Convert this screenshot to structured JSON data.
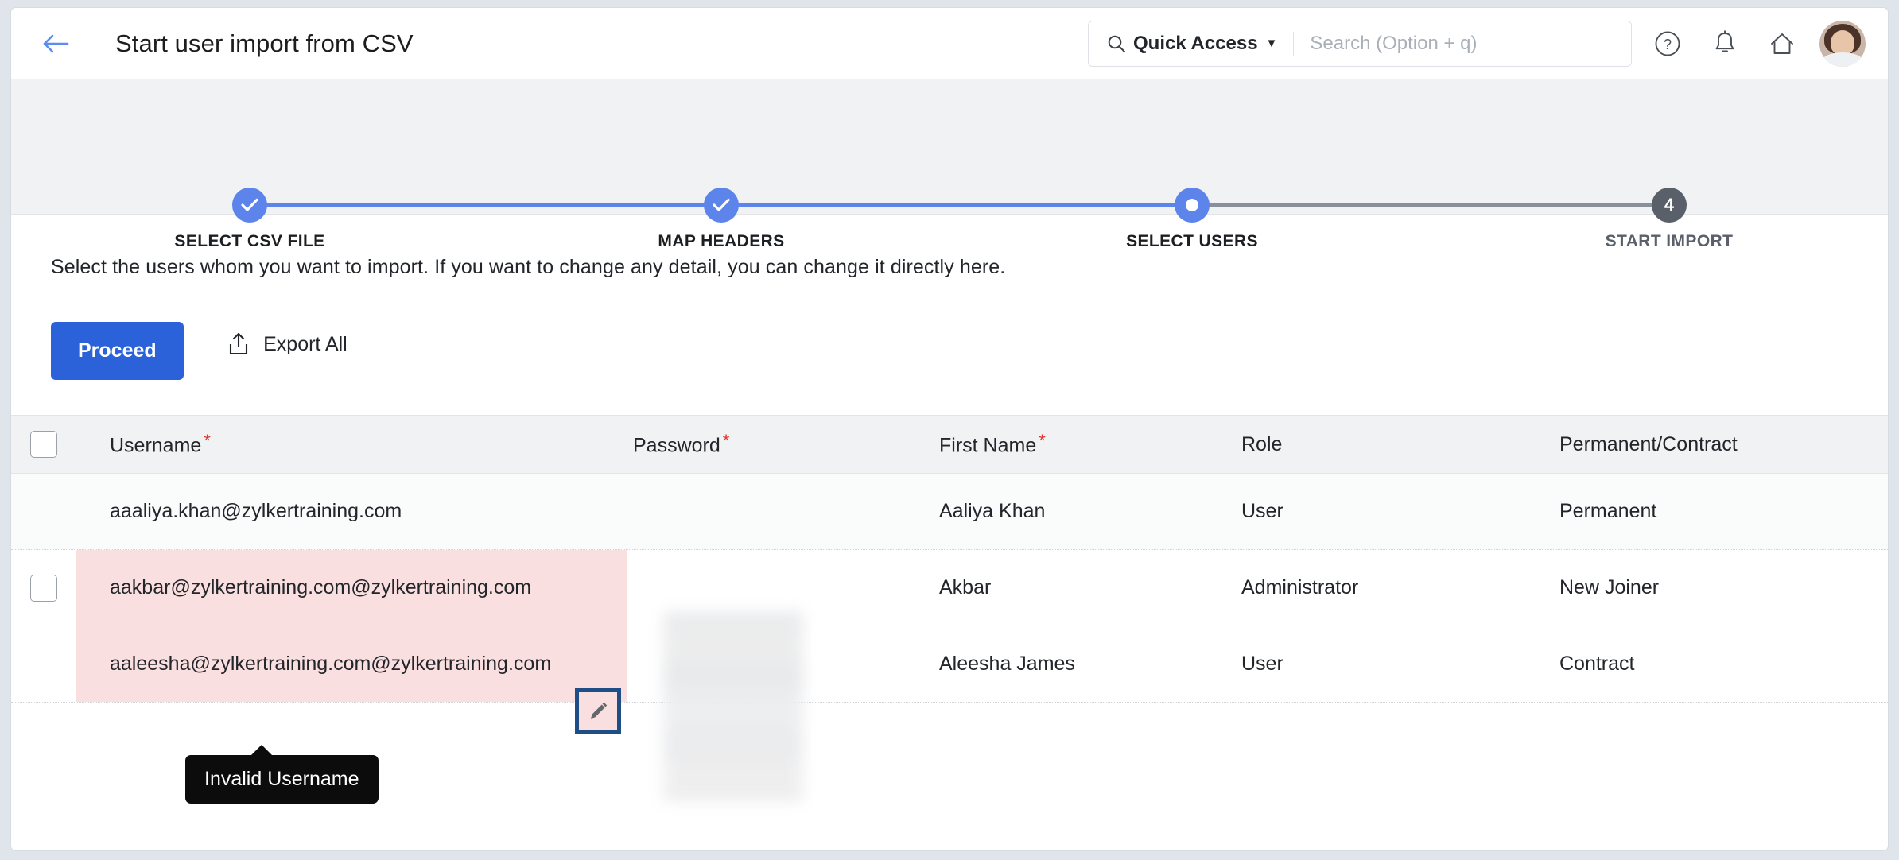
{
  "header": {
    "back_icon": "arrow-left-icon",
    "title": "Start user import from CSV",
    "search": {
      "search_icon": "search-icon",
      "scope_label": "Quick Access",
      "caret": "▼",
      "placeholder": "Search (Option + q)",
      "value": ""
    },
    "help_icon": "help-circle-icon",
    "bell_icon": "bell-icon",
    "home_icon": "home-icon",
    "avatar": "user-avatar"
  },
  "stepper": {
    "steps": [
      {
        "label": "SELECT CSV FILE",
        "state": "done",
        "marker": "✓"
      },
      {
        "label": "MAP HEADERS",
        "state": "done",
        "marker": "✓"
      },
      {
        "label": "SELECT USERS",
        "state": "current",
        "marker": ""
      },
      {
        "label": "START IMPORT",
        "state": "todo",
        "marker": "4"
      }
    ],
    "colors": {
      "done": "#5c84ea",
      "todo": "#5a6069",
      "track_done": "#5c84ea",
      "track_todo": "#8a9099"
    }
  },
  "main": {
    "instruction": "Select the users whom you want to import. If you want to change any detail, you can change it directly here.",
    "proceed_label": "Proceed",
    "export_label": "Export All",
    "export_icon": "upload-share-icon"
  },
  "table": {
    "columns": [
      {
        "key": "username",
        "label": "Username",
        "required": true
      },
      {
        "key": "password",
        "label": "Password",
        "required": true
      },
      {
        "key": "first",
        "label": "First Name",
        "required": true
      },
      {
        "key": "role",
        "label": "Role",
        "required": false
      },
      {
        "key": "perm",
        "label": "Permanent/Contract",
        "required": false
      }
    ],
    "required_marker": "*",
    "header_checkbox": {
      "checked": false
    },
    "rows": [
      {
        "checkbox_visible": false,
        "checked": false,
        "username": "aaaliya.khan@zylkertraining.com",
        "password_masked": true,
        "first": "Aaliya Khan",
        "role": "User",
        "perm": "Permanent",
        "error": false
      },
      {
        "checkbox_visible": true,
        "checked": false,
        "username": "aakbar@zylkertraining.com@zylkertraining.com",
        "password_masked": true,
        "first": "Akbar",
        "role": "Administrator",
        "perm": "New Joiner",
        "error": true
      },
      {
        "checkbox_visible": false,
        "checked": false,
        "username": "aaleesha@zylkertraining.com@zylkertraining.com",
        "password_masked": true,
        "first": "Aleesha James",
        "role": "User",
        "perm": "Contract",
        "error": true
      }
    ],
    "error_row_bg": "#fadfe0"
  },
  "overlays": {
    "tooltip_text": "Invalid Username",
    "edit_icon": "pencil-edit-icon",
    "edit_focus_color": "#1f4e86"
  },
  "colors": {
    "accent_blue": "#2b62d9",
    "step_blue": "#5c84ea",
    "required_red": "#e0352b",
    "band_gray": "#f0f2f4",
    "page_bg": "#dfe5ea"
  }
}
